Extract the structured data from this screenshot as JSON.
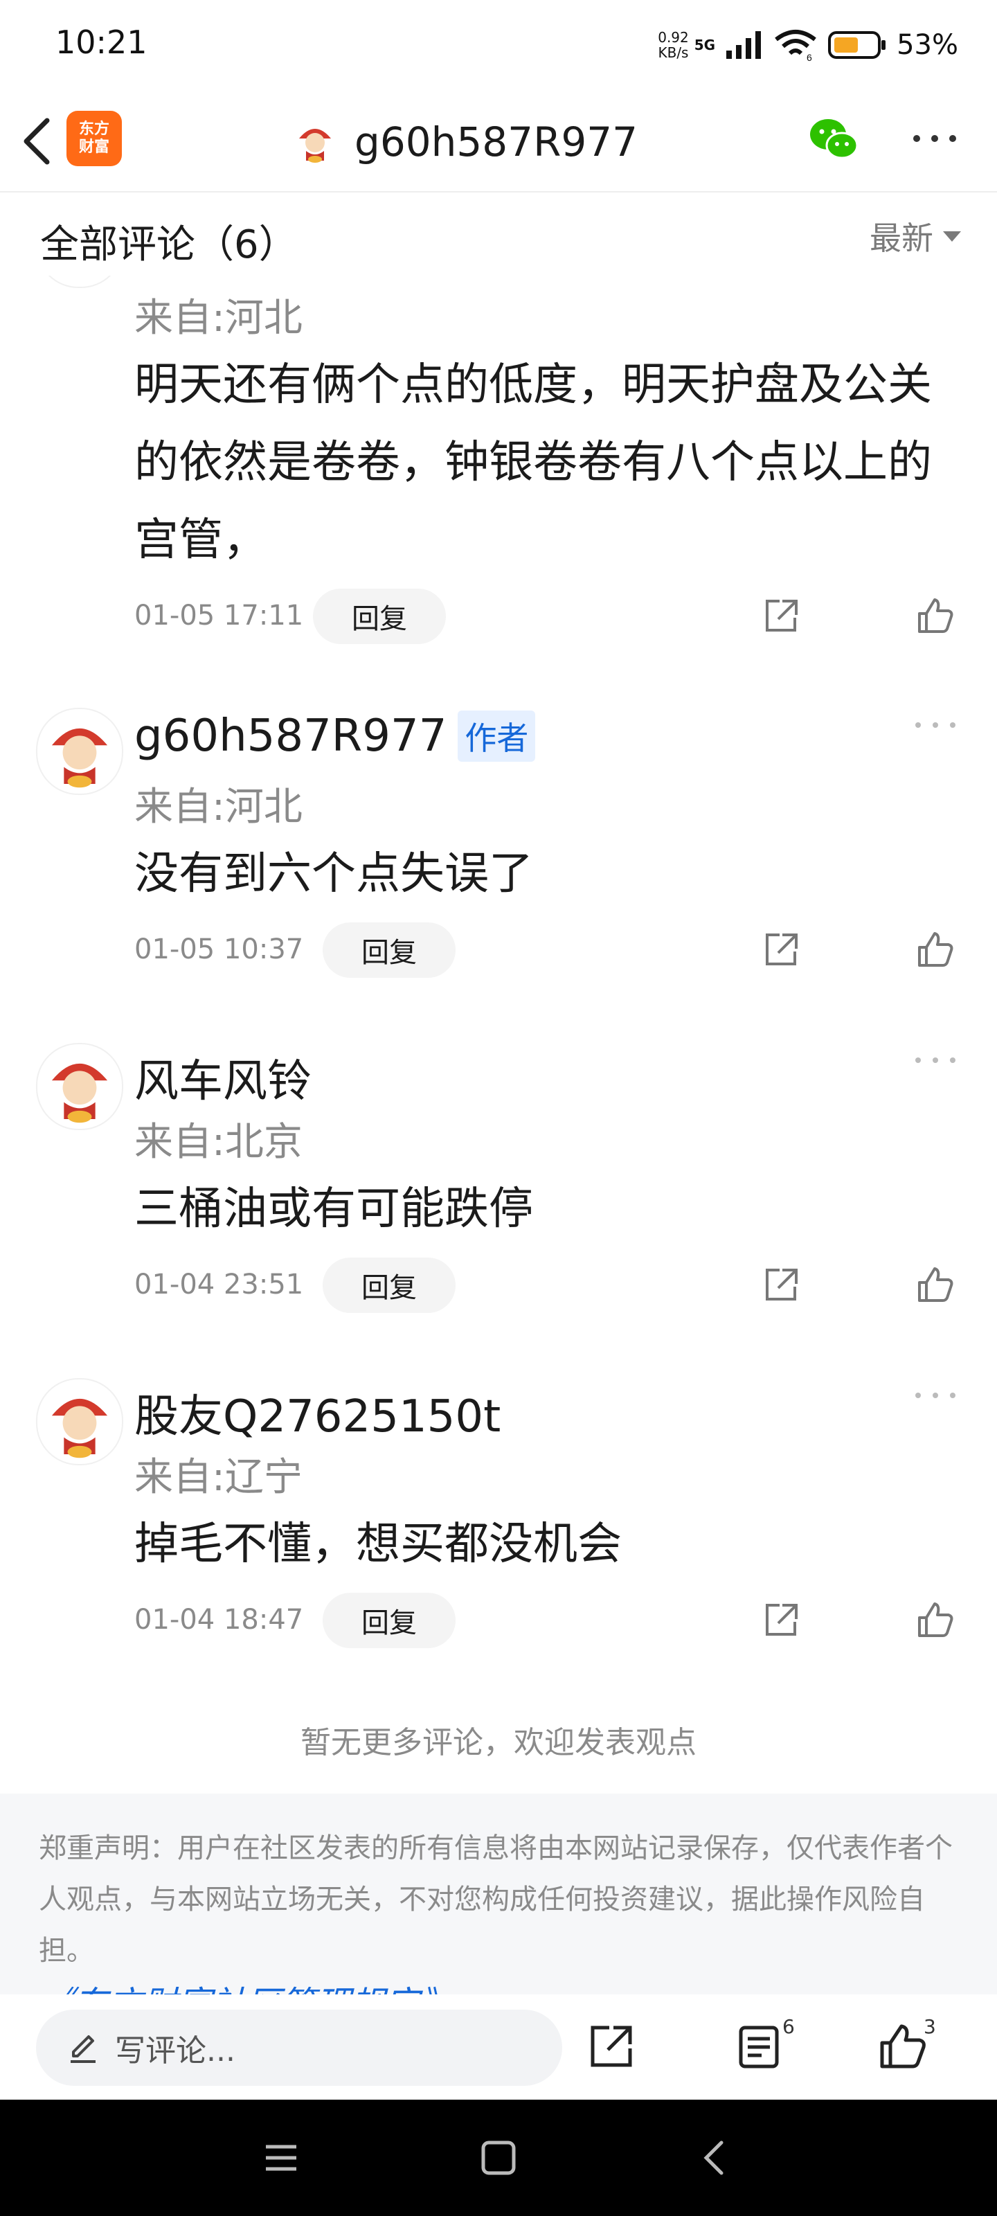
{
  "status_bar": {
    "time": "10:21",
    "net_speed_value": "0.92",
    "net_speed_unit": "KB/s",
    "network_gen": "5G",
    "wifi_sub": "6",
    "battery_percent": "53%"
  },
  "nav": {
    "logo_line1": "东方",
    "logo_line2": "财富",
    "title": "g60h587R977"
  },
  "comments_header": {
    "title": "全部评论（6）",
    "sort_label": "最新"
  },
  "comments": [
    {
      "user": "",
      "location": "来自:河北",
      "text": "明天还有俩个点的低度，明天护盘及公关的依然是卷卷，钟银卷卷有八个点以上的宫管，",
      "time": "01-05 17:11",
      "reply_label": "回复"
    },
    {
      "user": "g60h587R977",
      "author_badge": "作者",
      "location": "来自:河北",
      "text": "没有到六个点失误了",
      "time": "01-05 10:37",
      "reply_label": "回复"
    },
    {
      "user": "风车风铃",
      "location": "来自:北京",
      "text": "三桶油或有可能跌停",
      "time": "01-04 23:51",
      "reply_label": "回复"
    },
    {
      "user": "股友Q27625150t",
      "location": "来自:辽宁",
      "text": "掉毛不懂，想买都没机会",
      "time": "01-04 18:47",
      "reply_label": "回复"
    }
  ],
  "end_text": "暂无更多评论，欢迎发表观点",
  "disclaimer": {
    "text": "郑重声明：用户在社区发表的所有信息将由本网站记录保存，仅代表作者个人观点，与本网站立场无关，不对您构成任何投资建议，据此操作风险自担。",
    "link": "《东方财富社区管理规定》"
  },
  "bottom_bar": {
    "write_placeholder": "写评论...",
    "comment_count": "6",
    "like_count": "3"
  },
  "colors": {
    "accent_blue": "#1668d9",
    "logo_orange": "#ff6a16",
    "wechat_green": "#2dc100",
    "gray_text": "#8a8a8a"
  },
  "icons": [
    "back-icon",
    "wechat-icon",
    "more-icon",
    "share-icon",
    "like-icon",
    "pencil-icon",
    "comment-list-icon",
    "menu-icon",
    "home-icon",
    "back-nav-icon"
  ]
}
